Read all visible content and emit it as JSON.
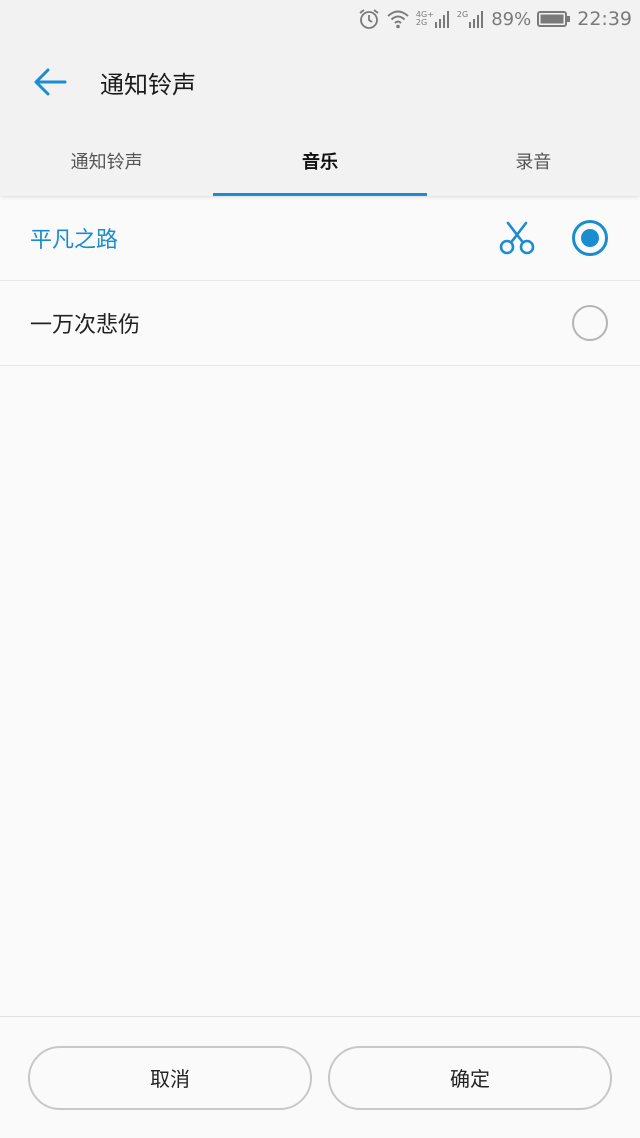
{
  "status_bar": {
    "network_top": "4G+",
    "network_bottom": "2G",
    "network2": "2G",
    "battery_percent": "89%",
    "time": "22:39",
    "icons": [
      "alarm-icon",
      "wifi-icon",
      "signal-icon",
      "signal-icon",
      "battery-icon"
    ]
  },
  "app_bar": {
    "title": "通知铃声",
    "back_icon": "arrow-left-icon"
  },
  "tabs": [
    {
      "label": "通知铃声",
      "active": false
    },
    {
      "label": "音乐",
      "active": true
    },
    {
      "label": "录音",
      "active": false
    }
  ],
  "songs": [
    {
      "title": "平凡之路",
      "selected": true,
      "icon": "scissors-icon"
    },
    {
      "title": "一万次悲伤",
      "selected": false
    }
  ],
  "footer": {
    "cancel_label": "取消",
    "confirm_label": "确定"
  },
  "colors": {
    "accent": "#1a8ccf",
    "header_bg": "#f2f2f2",
    "page_bg": "#fafafa"
  }
}
